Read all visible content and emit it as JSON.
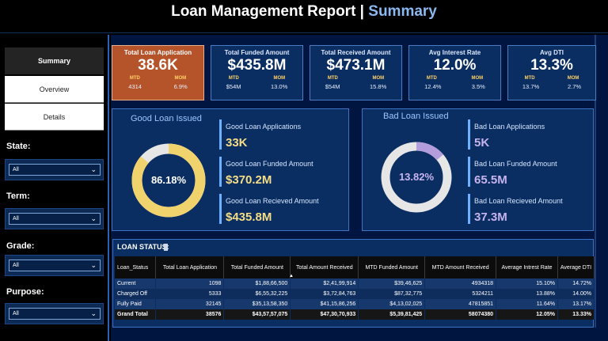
{
  "header": {
    "title": "Loan Management Report |",
    "title_accent": "Summary"
  },
  "sidebar": {
    "nav": [
      {
        "label": "Summary",
        "active": true
      },
      {
        "label": "Overview",
        "active": false
      },
      {
        "label": "Details",
        "active": false
      }
    ],
    "filters": [
      {
        "label": "State:",
        "value": "All"
      },
      {
        "label": "Term:",
        "value": "All"
      },
      {
        "label": "Grade:",
        "value": "All"
      },
      {
        "label": "Purpose:",
        "value": "All"
      }
    ]
  },
  "kpis": [
    {
      "title": "Total Loan Application",
      "value": "38.6K",
      "mtd_label": "MTD",
      "mom_label": "MOM",
      "mtd": "4314",
      "mom": "6.9%"
    },
    {
      "title": "Total Funded Amount",
      "value": "$435.8M",
      "mtd_label": "MTD",
      "mom_label": "MOM",
      "mtd": "$54M",
      "mom": "13.0%"
    },
    {
      "title": "Total Received Amount",
      "value": "$473.1M",
      "mtd_label": "MTD",
      "mom_label": "MOM",
      "mtd": "$54M",
      "mom": "15.8%"
    },
    {
      "title": "Avg Interest Rate",
      "value": "12.0%",
      "mtd_label": "MTD",
      "mom_label": "MOM",
      "mtd": "12.4%",
      "mom": "3.5%"
    },
    {
      "title": "Avg DTI",
      "value": "13.3%",
      "mtd_label": "MTD",
      "mom_label": "MOM",
      "mtd": "13.7%",
      "mom": "2.7%"
    }
  ],
  "good_loan": {
    "title": "Good Loan Issued",
    "percent_label": "86.18%",
    "percent": 86.18,
    "metrics": [
      {
        "label": "Good Loan Applications",
        "value": "33K"
      },
      {
        "label": "Good Loan Funded Amount",
        "value": "$370.2M"
      },
      {
        "label": "Good Loan Recieved Amount",
        "value": "$435.8M"
      }
    ]
  },
  "bad_loan": {
    "title": "Bad Loan Issued",
    "percent_label": "13.82%",
    "percent": 13.82,
    "metrics": [
      {
        "label": "Bad Loan Applications",
        "value": "5K"
      },
      {
        "label": "Bad Loan Funded Amount",
        "value": "65.5M"
      },
      {
        "label": "Bad Loan Recieved Amount",
        "value": "37.3M"
      }
    ]
  },
  "colors": {
    "good_ring": "#f1d36e",
    "bad_ring": "#b39ddb",
    "ring_rest": "#e6e6e6",
    "good_value": "#f5dd86",
    "bad_value": "#c7b4ee"
  },
  "loan_status": {
    "title": "LOAN STATUS:",
    "columns": [
      "Loan_Status",
      "Total Loan Application",
      "Total Funded Amount",
      "Total Amount Received",
      "MTD Funded Amount",
      "MTD Amount Received",
      "Average Intrest Rate",
      "Average DTI"
    ],
    "rows": [
      [
        "Current",
        "1098",
        "$1,88,66,500",
        "$2,41,99,914",
        "$39,46,625",
        "4934318",
        "15.10%",
        "14.72%"
      ],
      [
        "Charged Off",
        "5333",
        "$6,55,32,225",
        "$3,72,84,763",
        "$87,32,775",
        "5324211",
        "13.88%",
        "14.00%"
      ],
      [
        "Fully Paid",
        "32145",
        "$35,13,58,350",
        "$41,15,86,256",
        "$4,13,02,025",
        "47815851",
        "11.64%",
        "13.17%"
      ]
    ],
    "total": [
      "Grand Total",
      "38576",
      "$43,57,57,075",
      "$47,30,70,933",
      "$5,39,81,425",
      "58074380",
      "12.05%",
      "13.33%"
    ]
  }
}
